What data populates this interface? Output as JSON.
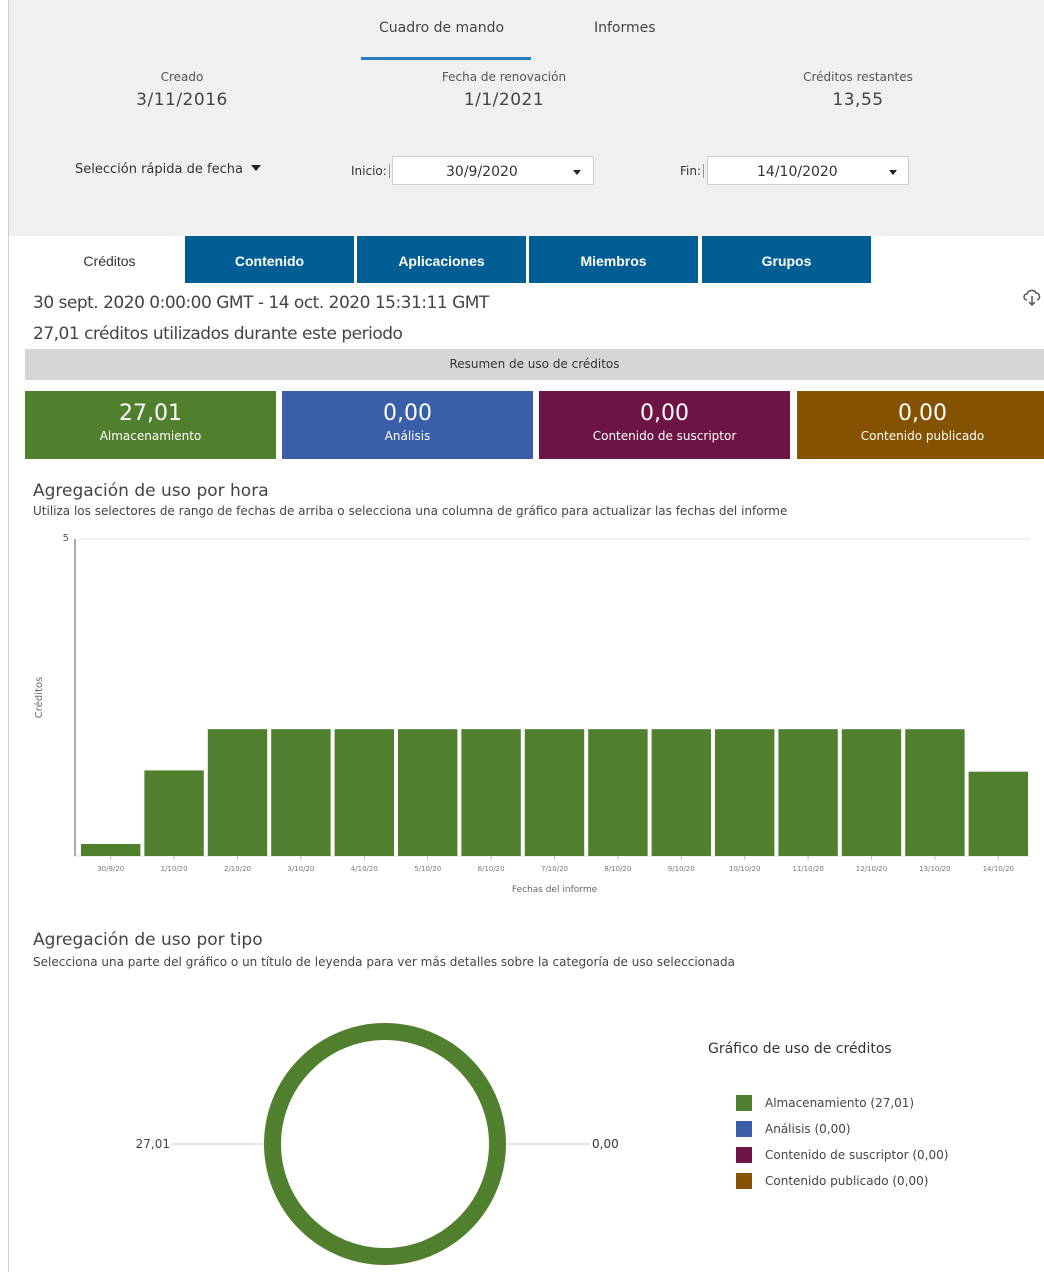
{
  "nav": {
    "tabs": [
      {
        "label": "Cuadro de mando"
      },
      {
        "label": "Informes"
      }
    ]
  },
  "summary": {
    "created": {
      "label": "Creado",
      "value": "3/11/2016"
    },
    "renewal": {
      "label": "Fecha de renovación",
      "value": "1/1/2021"
    },
    "remaining": {
      "label": "Créditos restantes",
      "value": "13,55"
    }
  },
  "filters": {
    "quick_label": "Selección rápida de fecha",
    "start_label": "Inicio:",
    "start_value": "30/9/2020",
    "end_label": "Fin:",
    "end_value": "14/10/2020"
  },
  "section_tabs": [
    {
      "label": "Créditos"
    },
    {
      "label": "Contenido"
    },
    {
      "label": "Aplicaciones"
    },
    {
      "label": "Miembros"
    },
    {
      "label": "Grupos"
    }
  ],
  "period": "30 sept. 2020 0:00:00 GMT - 14 oct. 2020 15:31:11 GMT",
  "used_text": "27,01 créditos utilizados durante este periodo",
  "resumen_title": "Resumen de uso de créditos",
  "tiles": [
    {
      "value": "27,01",
      "label": "Almacenamiento",
      "color": "#507f2d"
    },
    {
      "value": "0,00",
      "label": "Análisis",
      "color": "#3a5fa8"
    },
    {
      "value": "0,00",
      "label": "Contenido de suscriptor",
      "color": "#6e1444"
    },
    {
      "value": "0,00",
      "label": "Contenido publicado",
      "color": "#845200"
    }
  ],
  "hourly": {
    "title": "Agregación de uso por hora",
    "subtitle": "Utiliza los selectores de rango de fechas de arriba o selecciona una columna de gráfico para actualizar las fechas del informe"
  },
  "bytype": {
    "title": "Agregación de uso por tipo",
    "subtitle": "Selecciona una parte del gráfico o un título de leyenda para ver más detalles sobre la categoría de uso seleccionada",
    "legend_title": "Gráfico de uso de créditos",
    "left_label": "27,01",
    "right_label": "0,00"
  },
  "chart_data": [
    {
      "type": "bar",
      "title": "Agregación de uso por hora",
      "xlabel": "Fechas del informe",
      "ylabel": "Créditos",
      "ylim": [
        0,
        5
      ],
      "yticks": [
        "5"
      ],
      "categories": [
        "30/9/20",
        "1/10/20",
        "2/10/20",
        "3/10/20",
        "4/10/20",
        "5/10/20",
        "6/10/20",
        "7/10/20",
        "8/10/20",
        "9/10/20",
        "10/10/20",
        "11/10/20",
        "12/10/20",
        "13/10/20",
        "14/10/20"
      ],
      "values": [
        0.19,
        1.35,
        2.0,
        2.0,
        2.0,
        2.0,
        2.0,
        2.0,
        2.0,
        2.0,
        2.0,
        2.0,
        2.0,
        2.0,
        1.33
      ],
      "color": "#507f2d",
      "grid": true
    },
    {
      "type": "pie",
      "title": "Gráfico de uso de créditos",
      "labels": [
        "Almacenamiento (27,01)",
        "Análisis (0,00)",
        "Contenido de suscriptor (0,00)",
        "Contenido publicado (0,00)"
      ],
      "values": [
        27.01,
        0.0,
        0.0,
        0.0
      ],
      "colors": [
        "#507f2d",
        "#3a5fa8",
        "#6e1444",
        "#845200"
      ],
      "legend": "right"
    }
  ]
}
